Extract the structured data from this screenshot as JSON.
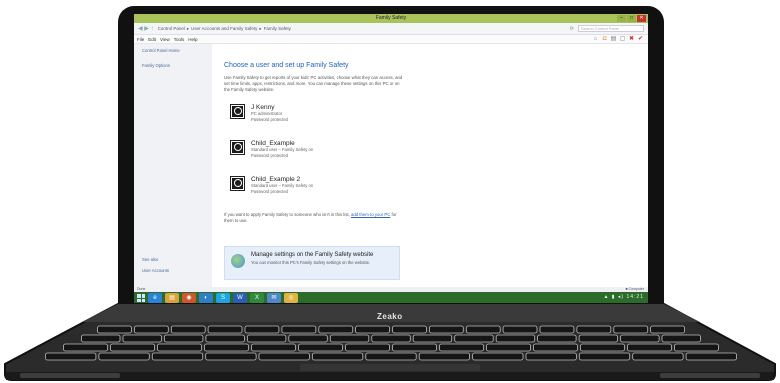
{
  "window": {
    "title": "Family Safety",
    "min": "–",
    "max": "□",
    "close": "✕"
  },
  "addressbar": {
    "back": "◀ ▶ ↑",
    "crumbs": [
      "Control Panel",
      "User Accounts and Family Safety",
      "Family Safety"
    ],
    "refresh": "⟳",
    "search_placeholder": "Search Control Panel"
  },
  "menubar": {
    "items": [
      "File",
      "Edit",
      "View",
      "Tools",
      "Help"
    ]
  },
  "sidebar": {
    "items": [
      "Control Panel Home",
      "Family Options"
    ],
    "bottom": [
      "See also",
      "User Accounts"
    ]
  },
  "main": {
    "heading": "Choose a user and set up Family Safety",
    "intro": "Use Family Safety to get reports of your kids' PC activities, choose what they can access, and set time limits, apps, restrictions, and more. You can manage these settings on this PC or on the Family Safety website.",
    "users": [
      {
        "name": "J Kenny",
        "role": "PC administrator",
        "pw": "Password protected"
      },
      {
        "name": "Child_Example",
        "role": "Standard user – Family Safety on",
        "pw": "Password protected"
      },
      {
        "name": "Child_Example 2",
        "role": "Standard user – Family Safety on",
        "pw": "Password protected"
      }
    ],
    "footnote_pre": "If you want to apply Family Safety to someone who isn't in this list,",
    "footnote_link": "add them to your PC",
    "footnote_post": " for them to use."
  },
  "website_box": {
    "title": "Manage settings on the Family Safety website",
    "desc": "You can monitor this PC's Family Safety settings on the website."
  },
  "statusbar": {
    "left": "Done",
    "right": "■ Computer"
  },
  "taskbar": {
    "apps": [
      "e",
      "▤",
      "◉",
      "◐",
      "S",
      "W",
      "X",
      "✉",
      "◎"
    ],
    "tray": "▲ ▮ ◂) 14:21"
  },
  "laptop": {
    "brand": "Zeako"
  },
  "colors": {
    "titlebar": "#a9c35a",
    "taskbar": "#2d6b2a",
    "link": "#1e63b8"
  }
}
